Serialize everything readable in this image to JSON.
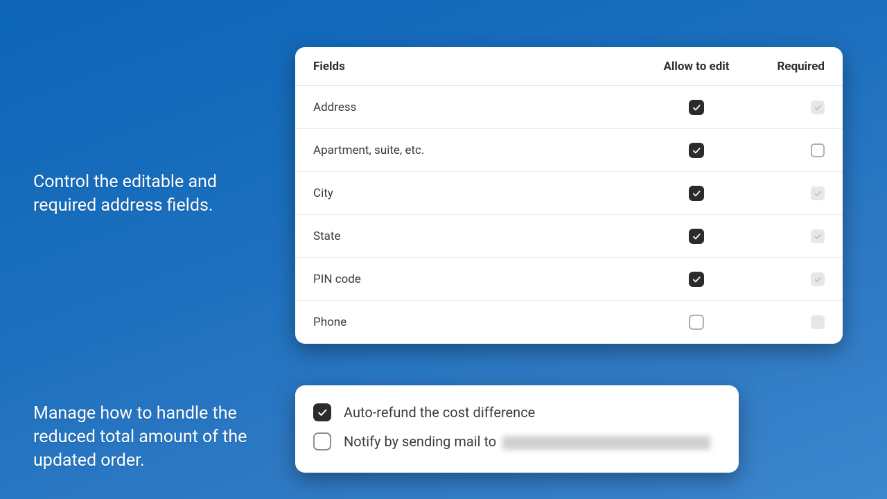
{
  "captions": {
    "fields": "Control the editable and required address fields.",
    "refund": "Manage how to handle the reduced total amount of the updated order."
  },
  "fields_table": {
    "head": {
      "fields": "Fields",
      "allow": "Allow to edit",
      "required": "Required"
    },
    "rows": [
      {
        "label": "Address",
        "allow": "checked_dark",
        "req": "checked_dim"
      },
      {
        "label": "Apartment, suite, etc.",
        "allow": "checked_dark",
        "req": "empty_bordered"
      },
      {
        "label": "City",
        "allow": "checked_dark",
        "req": "checked_dim"
      },
      {
        "label": "State",
        "allow": "checked_dark",
        "req": "checked_dim"
      },
      {
        "label": "PIN code",
        "allow": "checked_dark",
        "req": "checked_dim"
      },
      {
        "label": "Phone",
        "allow": "empty_bordered",
        "req": "empty_dim"
      }
    ]
  },
  "refund": {
    "auto_refund_label": "Auto-refund the cost difference",
    "notify_label_prefix": "Notify by sending mail to"
  }
}
